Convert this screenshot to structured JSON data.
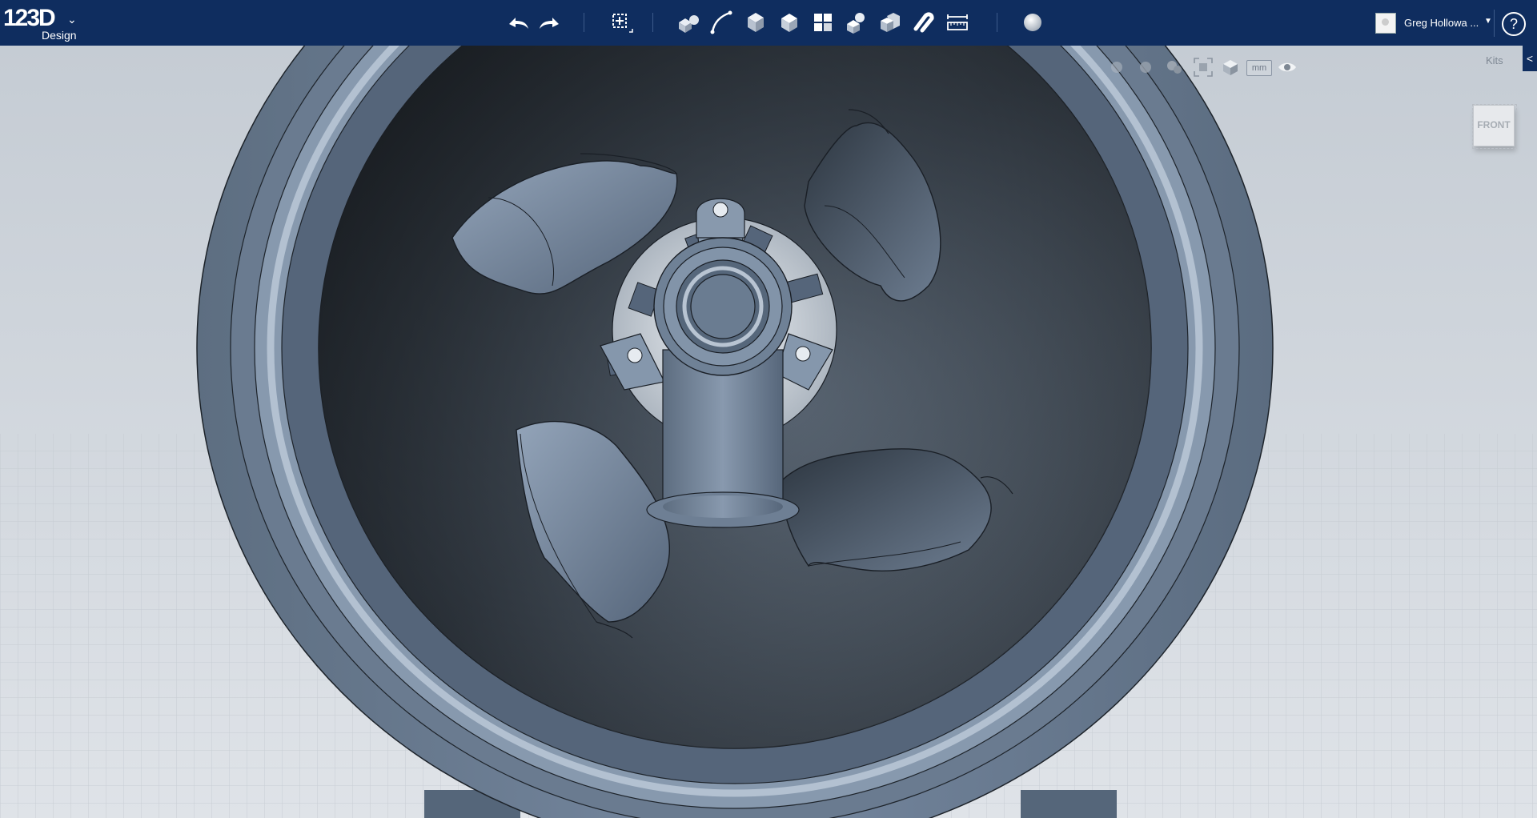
{
  "app": {
    "logo_text": "123D",
    "logo_sub": "Design"
  },
  "toolbar": {
    "undo": "undo-icon",
    "redo": "redo-icon",
    "tools": [
      "transform-icon",
      "primitives-icon",
      "sketch-icon",
      "construct-icon",
      "modify-icon",
      "pattern-icon",
      "grouping-icon",
      "combine-icon",
      "snap-icon",
      "measure-icon",
      "material-icon"
    ]
  },
  "user": {
    "name": "Greg Hollowa ...",
    "help": "?"
  },
  "view_tools": {
    "units": "mm",
    "kits": "Kits",
    "side_tab": "<"
  },
  "viewcube": {
    "label": "FRONT"
  },
  "colors": {
    "toolbar_bg": "#0f2d5f",
    "model_surface": "#6b7d92",
    "background": "#c9cfd6"
  }
}
